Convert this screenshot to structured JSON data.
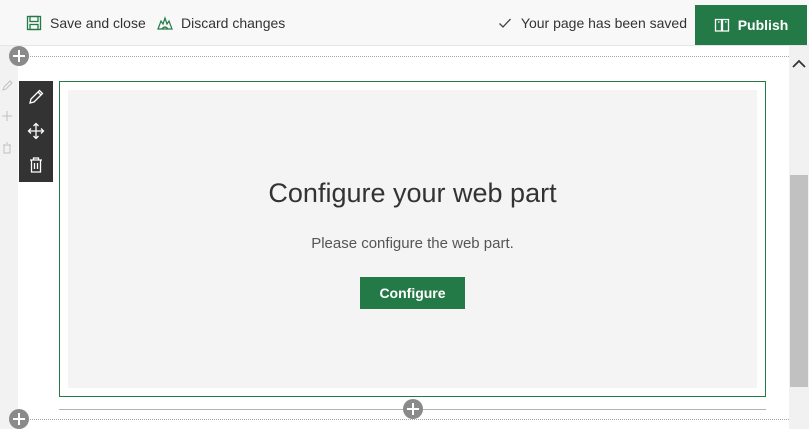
{
  "command_bar": {
    "save_close_label": "Save and close",
    "discard_label": "Discard changes",
    "status_text": "Your page has been saved",
    "publish_label": "Publish",
    "icons": {
      "save": "save-icon",
      "discard": "discard-icon",
      "status": "checkmark-icon",
      "publish": "book-icon"
    }
  },
  "webpart": {
    "title": "Configure your web part",
    "description": "Please configure the web part.",
    "configure_label": "Configure",
    "toolbar_icons": [
      "edit-icon",
      "move-icon",
      "delete-icon"
    ]
  },
  "colors": {
    "accent": "#237a47",
    "toolbar_bg": "#333333",
    "add_section": "#8a8a8a"
  }
}
